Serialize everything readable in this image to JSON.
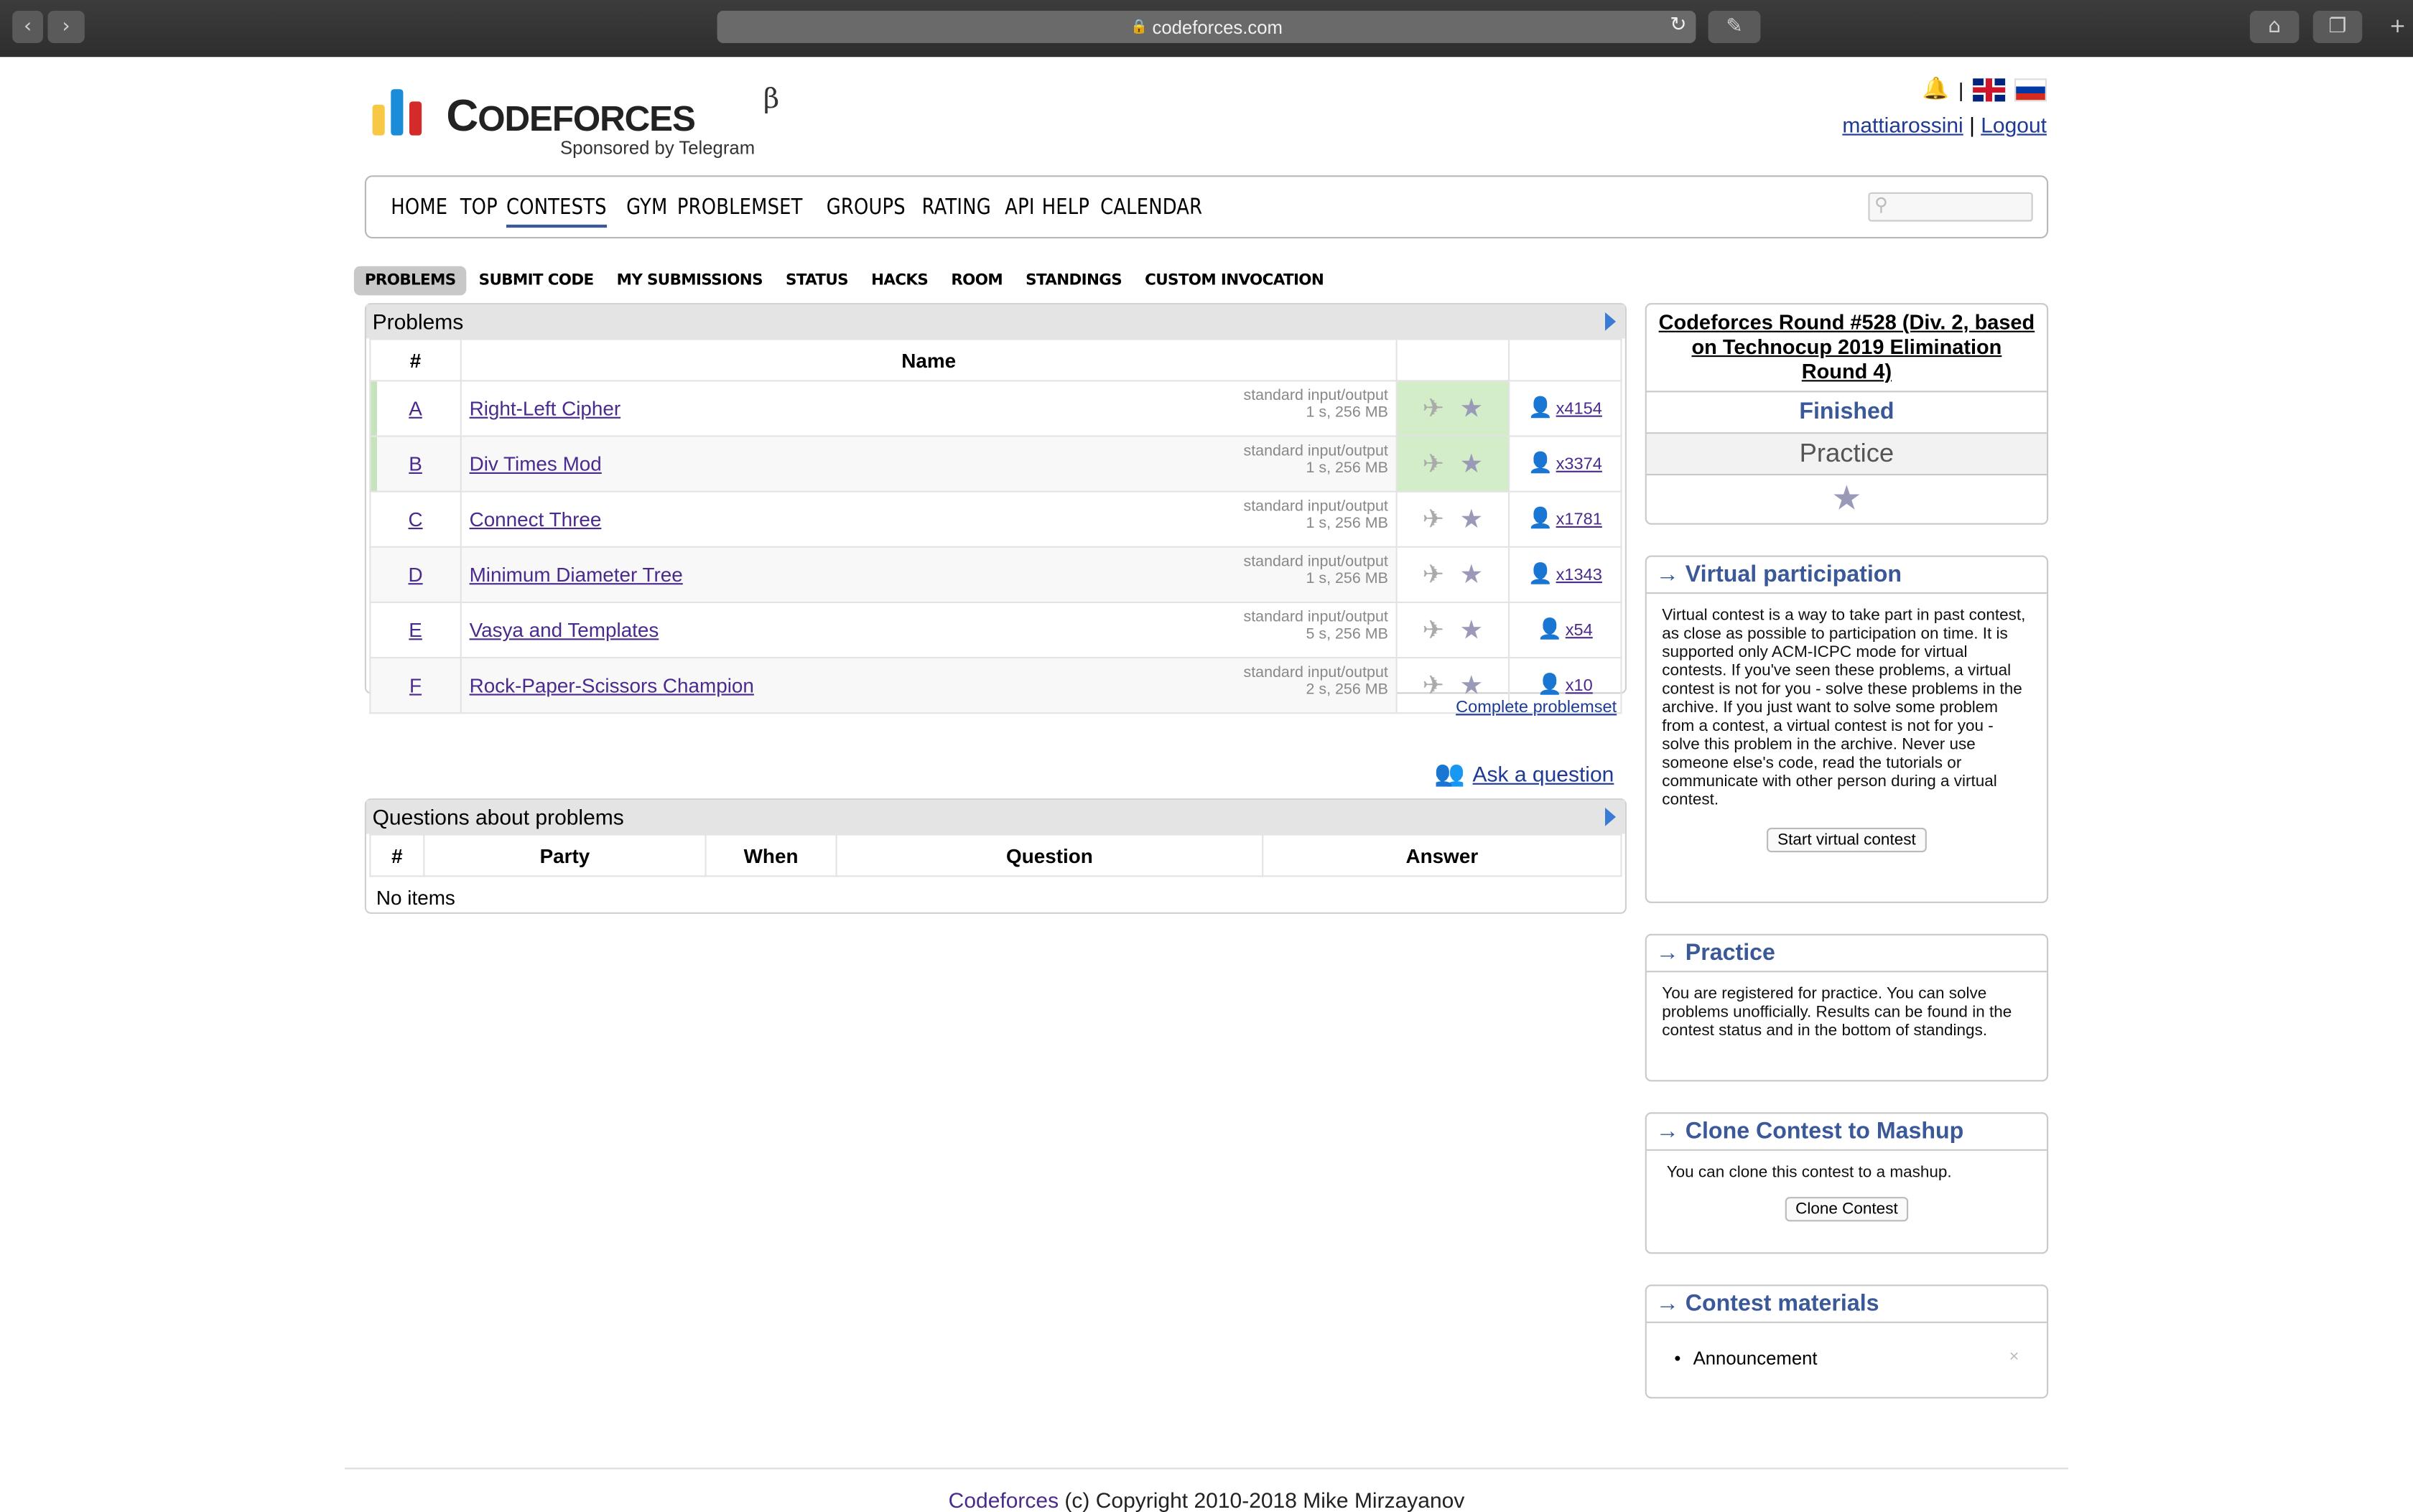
{
  "browser": {
    "url": "codeforces.com"
  },
  "header": {
    "logo_text_big": "C",
    "logo_text_rest": "ODEFORCES",
    "logo_beta": "β",
    "sponsor": "Sponsored by Telegram",
    "username": "mattiarossini",
    "separator": "|",
    "logout": "Logout"
  },
  "nav": {
    "items": [
      "HOME",
      "TOP",
      "CONTESTS",
      "GYM",
      "PROBLEMSET",
      "GROUPS",
      "RATING",
      "API",
      "HELP",
      "CALENDAR"
    ],
    "active": "CONTESTS"
  },
  "submenu": {
    "items": [
      "PROBLEMS",
      "SUBMIT CODE",
      "MY SUBMISSIONS",
      "STATUS",
      "HACKS",
      "ROOM",
      "STANDINGS",
      "CUSTOM INVOCATION"
    ]
  },
  "problems": {
    "title": "Problems",
    "col_index": "#",
    "col_name": "Name",
    "rows": [
      {
        "index": "A",
        "name": "Right-Left Cipher",
        "io": "standard input/output",
        "limits": "1 s, 256 MB",
        "solvers": "x4154",
        "solved": true
      },
      {
        "index": "B",
        "name": "Div Times Mod",
        "io": "standard input/output",
        "limits": "1 s, 256 MB",
        "solvers": "x3374",
        "solved": true
      },
      {
        "index": "C",
        "name": "Connect Three",
        "io": "standard input/output",
        "limits": "1 s, 256 MB",
        "solvers": "x1781",
        "solved": false
      },
      {
        "index": "D",
        "name": "Minimum Diameter Tree",
        "io": "standard input/output",
        "limits": "1 s, 256 MB",
        "solvers": "x1343",
        "solved": false
      },
      {
        "index": "E",
        "name": "Vasya and Templates",
        "io": "standard input/output",
        "limits": "5 s, 256 MB",
        "solvers": "x54",
        "solved": false
      },
      {
        "index": "F",
        "name": "Rock-Paper-Scissors Champion",
        "io": "standard input/output",
        "limits": "2 s, 256 MB",
        "solvers": "x10",
        "solved": false
      }
    ],
    "complete_link": "Complete problemset"
  },
  "ask": {
    "label": "Ask a question"
  },
  "questions": {
    "title": "Questions about problems",
    "cols": [
      "#",
      "Party",
      "When",
      "Question",
      "Answer"
    ],
    "empty": "No items"
  },
  "sidebar": {
    "round": {
      "title": "Codeforces Round #528 (Div. 2, based on Technocup 2019 Elimination Round 4)",
      "status": "Finished",
      "mode": "Practice"
    },
    "virtual": {
      "title": "→ Virtual participation",
      "text": "Virtual contest is a way to take part in past contest, as close as possible to participation on time. It is supported only ACM-ICPC mode for virtual contests. If you've seen these problems, a virtual contest is not for you - solve these problems in the archive. If you just want to solve some problem from a contest, a virtual contest is not for you - solve this problem in the archive. Never use someone else's code, read the tutorials or communicate with other person during a virtual contest.",
      "button": "Start virtual contest"
    },
    "practice": {
      "title": "→ Practice",
      "text": "You are registered for practice. You can solve problems unofficially. Results can be found in the contest status and in the bottom of standings."
    },
    "clone": {
      "title": "→ Clone Contest to Mashup",
      "text": "You can clone this contest to a mashup.",
      "button": "Clone Contest"
    },
    "materials": {
      "title": "→ Contest materials",
      "items": [
        "Announcement"
      ]
    }
  },
  "footer": {
    "link": "Codeforces",
    "text": " (c) Copyright 2010-2018 Mike Mirzayanov"
  },
  "colors": {
    "link": "#1f3a93",
    "visited": "#4b2a8e",
    "accent": "#3b5998",
    "solved_bg": "#d4edc9"
  }
}
